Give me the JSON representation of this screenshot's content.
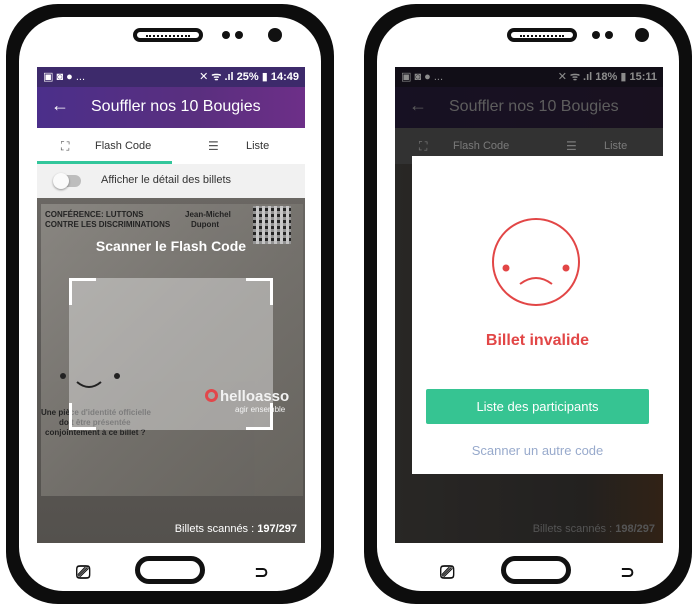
{
  "left_phone": {
    "status": {
      "left_icons": "▣ ◙ ● ...",
      "right": "✕ ᯤ .ıl 25% ▮ 14:49"
    },
    "app_title": "Souffler nos 10 Bougies",
    "tabs": {
      "flash": "Flash Code",
      "list": "Liste"
    },
    "toggle_label": "Afficher le détail des billets",
    "scan_title": "Scanner le Flash Code",
    "ticket_lines": {
      "heading1": "CONFÉRENCE: LUTTONS",
      "heading2": "CONTRE LES DISCRIMINATIONS",
      "name1": "Jean-Michel",
      "name2": "Dupont",
      "question1": "Une pièce d'identité officielle",
      "question2": "doit être présentée",
      "question3": "conjointement à ce billet ?",
      "logo": "helloasso",
      "tagline": "agir ensemble"
    },
    "scanned_label": "Billets scannés : ",
    "scanned_value": "197/297"
  },
  "right_phone": {
    "status": {
      "left_icons": "▣ ◙ ● ...",
      "right": "✕ ᯤ .ıl 18% ▮ 15:11"
    },
    "app_title": "Souffler nos 10 Bougies",
    "tabs": {
      "flash": "Flash Code",
      "list": "Liste"
    },
    "dialog": {
      "message": "Billet invalide",
      "primary_button": "Liste des participants",
      "secondary_link": "Scanner un autre code"
    },
    "scanned_label": "Billets scannés : ",
    "scanned_value": "198/297"
  },
  "colors": {
    "accent_green": "#36c492",
    "error_red": "#e24646",
    "appbar_purple": "#4b2f8a"
  }
}
